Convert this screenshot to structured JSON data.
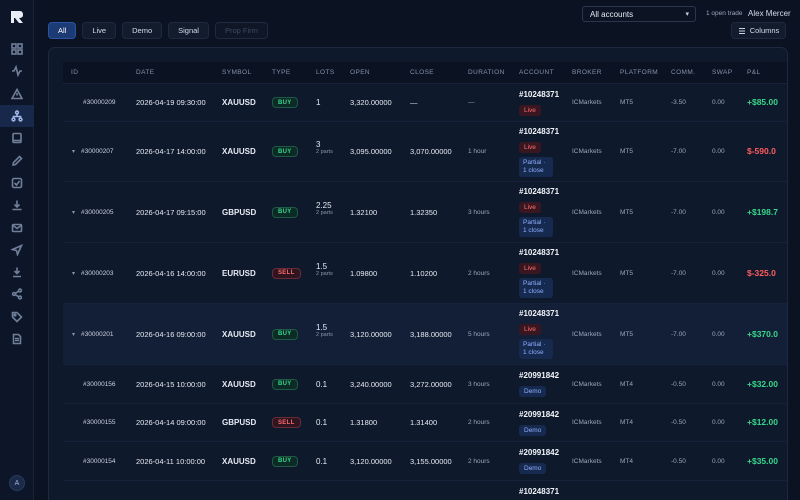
{
  "header": {
    "account_selector": "All accounts",
    "open_trades": "1 open trade",
    "user_name": "Alex Mercer",
    "avatar_initial": "A"
  },
  "filters": [
    "All",
    "Live",
    "Demo",
    "Signal",
    "Prop Firm"
  ],
  "columns_button": "Columns",
  "table": {
    "columns": [
      "ID",
      "DATE",
      "SYMBOL",
      "TYPE",
      "LOTS",
      "OPEN",
      "CLOSE",
      "DURATION",
      "ACCOUNT",
      "BROKER",
      "PLATFORM",
      "COMM.",
      "SWAP",
      "P&L"
    ],
    "rows": [
      {
        "id": "#30000209",
        "date": "2026-04-19 09:30:00",
        "symbol": "XAUUSD",
        "type": "BUY",
        "lots": "1",
        "parts": "",
        "open": "3,320.00000",
        "close": "—",
        "duration": "—",
        "account": "#10248371",
        "account_tag": "Live",
        "partial": "",
        "broker": "ICMarkets",
        "platform": "MT5",
        "comm": "-3.50",
        "swap": "0.00",
        "pnl": "+$85.00"
      },
      {
        "id": "#30000207",
        "date": "2026-04-17 14:00:00",
        "symbol": "XAUUSD",
        "type": "BUY",
        "lots": "3",
        "parts": "2 parts",
        "open": "3,095.00000",
        "close": "3,070.00000",
        "duration": "1 hour",
        "account": "#10248371",
        "account_tag": "Live",
        "partial": "Partial · 1 close",
        "broker": "ICMarkets",
        "platform": "MT5",
        "comm": "-7.00",
        "swap": "0.00",
        "pnl": "$-590.0"
      },
      {
        "id": "#30000205",
        "date": "2026-04-17 09:15:00",
        "symbol": "GBPUSD",
        "type": "BUY",
        "lots": "2.25",
        "parts": "2 parts",
        "open": "1.32100",
        "close": "1.32350",
        "duration": "3 hours",
        "account": "#10248371",
        "account_tag": "Live",
        "partial": "Partial · 1 close",
        "broker": "ICMarkets",
        "platform": "MT5",
        "comm": "-7.00",
        "swap": "0.00",
        "pnl": "+$198.7"
      },
      {
        "id": "#30000203",
        "date": "2026-04-16 14:00:00",
        "symbol": "EURUSD",
        "type": "SELL",
        "lots": "1.5",
        "parts": "2 parts",
        "open": "1.09800",
        "close": "1.10200",
        "duration": "2 hours",
        "account": "#10248371",
        "account_tag": "Live",
        "partial": "Partial · 1 close",
        "broker": "ICMarkets",
        "platform": "MT5",
        "comm": "-7.00",
        "swap": "0.00",
        "pnl": "$-325.0"
      },
      {
        "id": "#30000201",
        "date": "2026-04-16 09:00:00",
        "symbol": "XAUUSD",
        "type": "BUY",
        "lots": "1.5",
        "parts": "2 parts",
        "open": "3,120.00000",
        "close": "3,188.00000",
        "duration": "5 hours",
        "account": "#10248371",
        "account_tag": "Live",
        "partial": "Partial · 1 close",
        "broker": "ICMarkets",
        "platform": "MT5",
        "comm": "-7.00",
        "swap": "0.00",
        "pnl": "+$370.0"
      },
      {
        "id": "#30000156",
        "date": "2026-04-15 10:00:00",
        "symbol": "XAUUSD",
        "type": "BUY",
        "lots": "0.1",
        "parts": "",
        "open": "3,240.00000",
        "close": "3,272.00000",
        "duration": "3 hours",
        "account": "#20991842",
        "account_tag": "Demo",
        "partial": "",
        "broker": "ICMarkets",
        "platform": "MT4",
        "comm": "-0.50",
        "swap": "0.00",
        "pnl": "+$32.00"
      },
      {
        "id": "#30000155",
        "date": "2026-04-14 09:00:00",
        "symbol": "GBPUSD",
        "type": "SELL",
        "lots": "0.1",
        "parts": "",
        "open": "1.31800",
        "close": "1.31400",
        "duration": "2 hours",
        "account": "#20991842",
        "account_tag": "Demo",
        "partial": "",
        "broker": "ICMarkets",
        "platform": "MT4",
        "comm": "-0.50",
        "swap": "0.00",
        "pnl": "+$12.00"
      },
      {
        "id": "#30000154",
        "date": "2026-04-11 10:00:00",
        "symbol": "XAUUSD",
        "type": "BUY",
        "lots": "0.1",
        "parts": "",
        "open": "3,120.00000",
        "close": "3,155.00000",
        "duration": "2 hours",
        "account": "#20991842",
        "account_tag": "Demo",
        "partial": "",
        "broker": "ICMarkets",
        "platform": "MT4",
        "comm": "-0.50",
        "swap": "0.00",
        "pnl": "+$35.00"
      },
      {
        "id": "",
        "date": "",
        "symbol": "",
        "type": "",
        "lots": "",
        "parts": "",
        "open": "",
        "close": "",
        "duration": "",
        "account": "#10248371",
        "account_tag": "",
        "partial": "",
        "broker": "",
        "platform": "",
        "comm": "",
        "swap": "",
        "pnl": ""
      }
    ]
  },
  "colors": {
    "accent": "#1c3a73",
    "positive": "#37d68a",
    "negative": "#ff5c5c",
    "background": "#0b1322"
  },
  "sidebar_icons": [
    "grid-icon",
    "activity-icon",
    "alert-icon",
    "tree-icon",
    "book-icon",
    "pen-icon",
    "checkbox-icon",
    "download-icon",
    "mail-icon",
    "send-icon",
    "import-icon",
    "share-icon",
    "tag-icon",
    "document-icon"
  ]
}
